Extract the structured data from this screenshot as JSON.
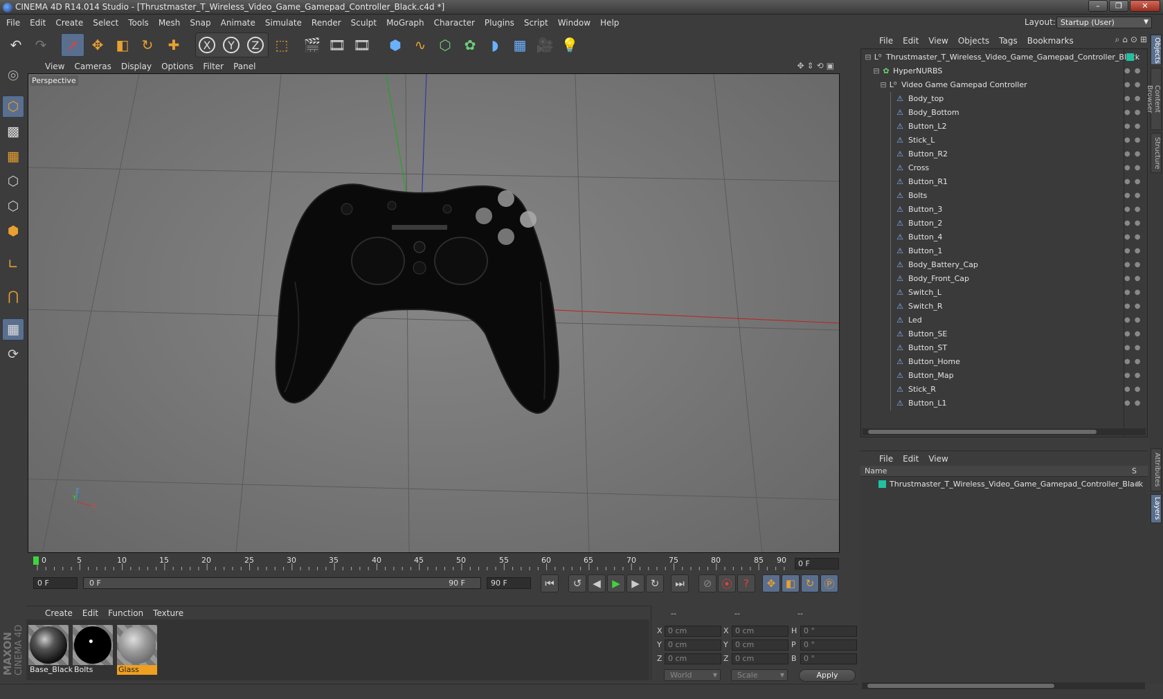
{
  "window": {
    "title": "CINEMA 4D R14.014 Studio - [Thrustmaster_T_Wireless_Video_Game_Gamepad_Controller_Black.c4d *]",
    "buttons": [
      "–",
      "❐",
      "✕"
    ]
  },
  "menubar": [
    "File",
    "Edit",
    "Create",
    "Select",
    "Tools",
    "Mesh",
    "Snap",
    "Animate",
    "Simulate",
    "Render",
    "Sculpt",
    "MoGraph",
    "Character",
    "Plugins",
    "Script",
    "Window",
    "Help"
  ],
  "layout": {
    "label": "Layout:",
    "value": "Startup (User)"
  },
  "toolbar": {
    "axis_x": "X",
    "axis_y": "Y",
    "axis_z": "Z"
  },
  "viewport": {
    "menu": [
      "View",
      "Cameras",
      "Display",
      "Options",
      "Filter",
      "Panel"
    ],
    "camera_label": "Perspective",
    "axis_labels": {
      "y": "Y",
      "z": "Z",
      "x": "X"
    }
  },
  "timeline": {
    "ticks": [
      "0",
      "5",
      "10",
      "15",
      "20",
      "25",
      "30",
      "35",
      "40",
      "45",
      "50",
      "55",
      "60",
      "65",
      "70",
      "75",
      "80",
      "85",
      "90"
    ],
    "current_frame": "0 F",
    "start_field": "0 F",
    "range_start": "0 F",
    "range_end": "90 F",
    "end_field": "90 F"
  },
  "materials": {
    "menu": [
      "Create",
      "Edit",
      "Function",
      "Texture"
    ],
    "items": [
      {
        "name": "Base_Black",
        "selected": false
      },
      {
        "name": "Bolts",
        "selected": false
      },
      {
        "name": "Glass",
        "selected": true
      }
    ]
  },
  "coordinates": {
    "headers": [
      "--",
      "--",
      "--"
    ],
    "rows": [
      {
        "a": "X",
        "av": "0 cm",
        "b": "X",
        "bv": "0 cm",
        "c": "H",
        "cv": "0 °"
      },
      {
        "a": "Y",
        "av": "0 cm",
        "b": "Y",
        "bv": "0 cm",
        "c": "P",
        "cv": "0 °"
      },
      {
        "a": "Z",
        "av": "0 cm",
        "b": "Z",
        "bv": "0 cm",
        "c": "B",
        "cv": "0 °"
      }
    ],
    "space": "World",
    "mode": "Scale",
    "apply": "Apply"
  },
  "branding": {
    "line1": "MAXON",
    "line2": "CINEMA 4D"
  },
  "objects": {
    "menu": [
      "File",
      "Edit",
      "View",
      "Objects",
      "Tags",
      "Bookmarks"
    ],
    "root": "Thrustmaster_T_Wireless_Video_Game_Gamepad_Controller_Black",
    "hypernurbs": "HyperNURBS",
    "group": "Video Game Gamepad Controller",
    "children": [
      "Body_top",
      "Body_Bottom",
      "Button_L2",
      "Stick_L",
      "Button_R2",
      "Cross",
      "Button_R1",
      "Bolts",
      "Button_3",
      "Button_2",
      "Button_4",
      "Button_1",
      "Body_Battery_Cap",
      "Body_Front_Cap",
      "Switch_L",
      "Switch_R",
      "Led",
      "Button_SE",
      "Button_ST",
      "Button_Home",
      "Button_Map",
      "Stick_R",
      "Button_L1"
    ]
  },
  "side_tabs": [
    "Objects",
    "Content Browser",
    "Structure",
    "Attributes",
    "Layers"
  ],
  "layers": {
    "menu": [
      "File",
      "Edit",
      "View"
    ],
    "col_name": "Name",
    "col_s": "S",
    "items": [
      "Thrustmaster_T_Wireless_Video_Game_Gamepad_Controller_Black"
    ]
  },
  "colors": {
    "accent": "#f0a020",
    "selection": "#5a6f8e",
    "layer_color": "#20c0a0"
  }
}
